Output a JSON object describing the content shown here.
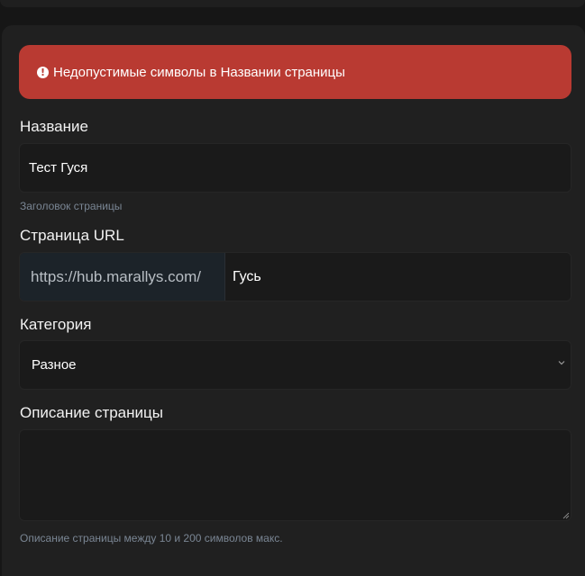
{
  "alert": {
    "message": "Недопустимые символы в Названии страницы",
    "color": "#b93a32"
  },
  "form": {
    "title": {
      "label": "Название",
      "value": "Тест Гуся",
      "help": "Заголовок страницы"
    },
    "url": {
      "label": "Страница URL",
      "prefix": "https://hub.marallys.com/",
      "value": "Гусь"
    },
    "category": {
      "label": "Категория",
      "selected": "Разное"
    },
    "description": {
      "label": "Описание страницы",
      "value": "",
      "help": "Описание страницы между 10 и 200 символов макс."
    }
  },
  "icons": {
    "alert": "exclamation-circle-icon",
    "select": "chevron-down-icon",
    "resize": "resize-handle-icon"
  }
}
